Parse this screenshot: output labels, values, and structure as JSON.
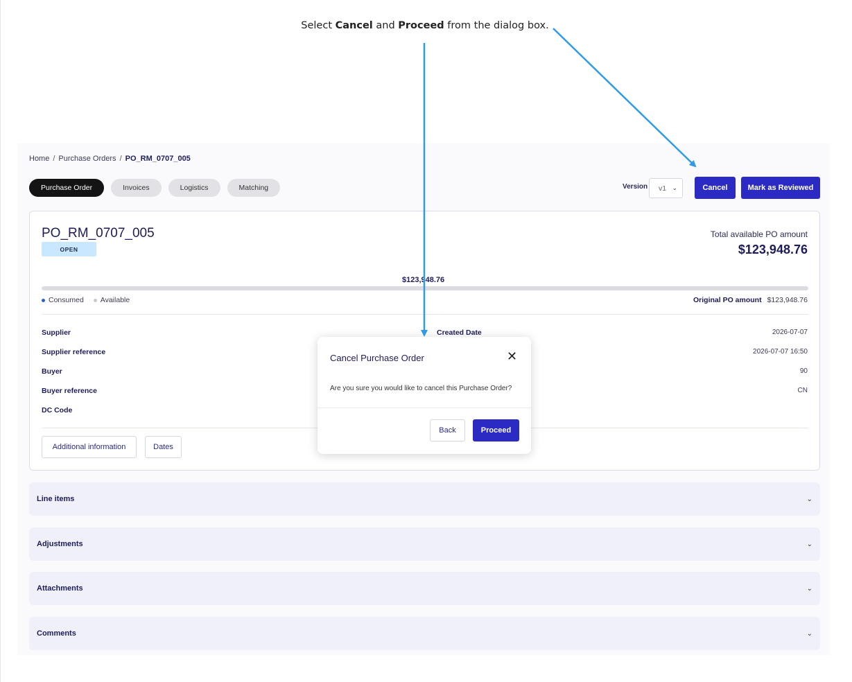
{
  "instruction": {
    "pre": "Select ",
    "cancel_word": "Cancel",
    "mid": " and ",
    "proceed_word": "Proceed",
    "post": " from the dialog box."
  },
  "breadcrumb": {
    "home": "Home",
    "sep": "/",
    "purchase_orders": "Purchase Orders",
    "current": "PO_RM_0707_005"
  },
  "tabs": [
    "Purchase Order",
    "Invoices",
    "Logistics",
    "Matching"
  ],
  "toolbar": {
    "version_label": "Version",
    "version_value": "v1",
    "cancel_label": "Cancel",
    "review_label": "Mark as Reviewed"
  },
  "po": {
    "id": "PO_RM_0707_005",
    "status": "OPEN",
    "total_label": "Total available PO amount",
    "total_value": "$123,948.76",
    "bar_amount": "$123,948.76",
    "consumed_fraction": 0,
    "legend_consumed": "Consumed",
    "legend_available": "Available",
    "original_label": "Original PO amount",
    "original_value": "$123,948.76"
  },
  "fields": {
    "supplier": "Supplier",
    "supplier_reference": "Supplier reference",
    "buyer": "Buyer",
    "buyer_reference": "Buyer reference",
    "dc_code": "DC Code",
    "created_date": "Created Date",
    "values": [
      "2026-07-07",
      "2026-07-07 16:50",
      "90",
      "CN"
    ]
  },
  "card_buttons": {
    "additional_info": "Additional information",
    "dates": "Dates"
  },
  "sections": [
    "Line items",
    "Adjustments",
    "Attachments",
    "Comments"
  ],
  "modal": {
    "title": "Cancel Purchase Order",
    "body": "Are you sure you would like to cancel this Purchase Order?",
    "back": "Back",
    "proceed": "Proceed"
  },
  "icons": {
    "close": "close-icon",
    "chevron": "chevron-down-icon"
  },
  "colors": {
    "primary": "#2b2bc4",
    "arrow": "#2f9ae6",
    "badge": "#c9e8ff"
  }
}
